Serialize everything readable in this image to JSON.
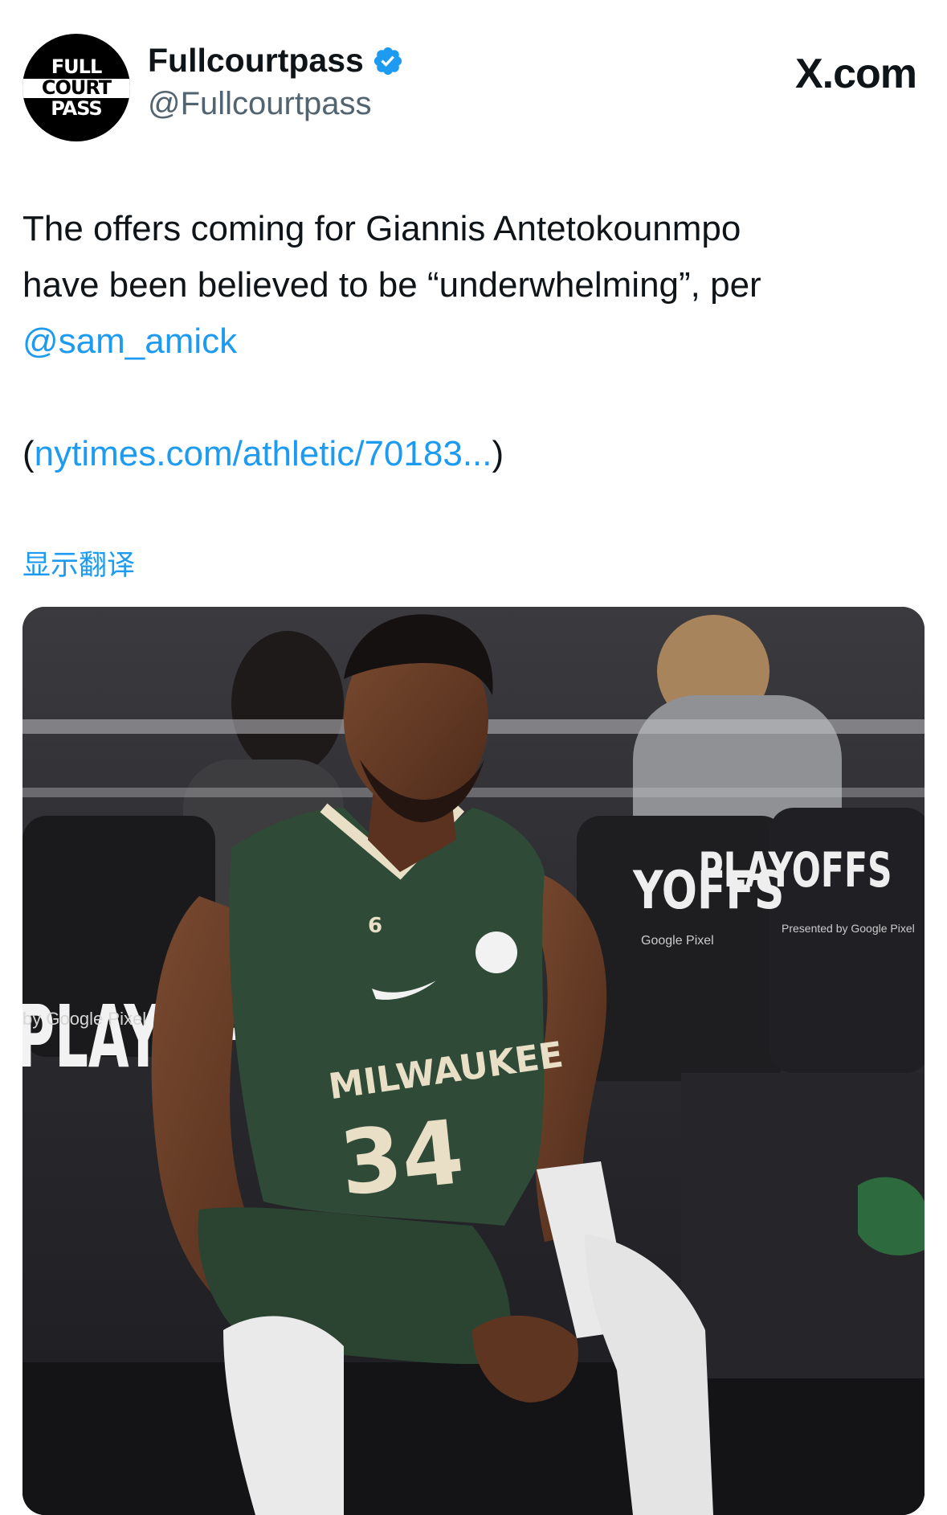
{
  "author": {
    "display_name": "Fullcourtpass",
    "handle": "@Fullcourtpass",
    "avatar_logo_lines": [
      "FULL",
      "COURT",
      "PASS"
    ],
    "verified_color": "#1d9bf0"
  },
  "source_label": "X.com",
  "tweet": {
    "line1": "The offers coming for Giannis Antetokounmpo",
    "line2": "have been believed to be “underwhelming”, per",
    "mention": "@sam_amick",
    "link_open": "(",
    "link_text": "nytimes.com/athletic/70183...",
    "link_close": ")"
  },
  "translate_label": "显示翻译",
  "media": {
    "signage_left": "PLAYOFFS",
    "signage_left_sub": "by Google Pixel",
    "signage_mid": "YOFFS",
    "signage_mid_sub": "Google Pixel",
    "signage_right": "PLAYOFFS",
    "signage_right_sub": "Presented by Google Pixel",
    "jersey_team": "MILWAUKEE",
    "jersey_number": "34",
    "shoulder_number": "6"
  },
  "colors": {
    "link": "#1d9bf0",
    "text": "#0f1419",
    "handle": "#536471",
    "jersey": "#2f4a36"
  }
}
